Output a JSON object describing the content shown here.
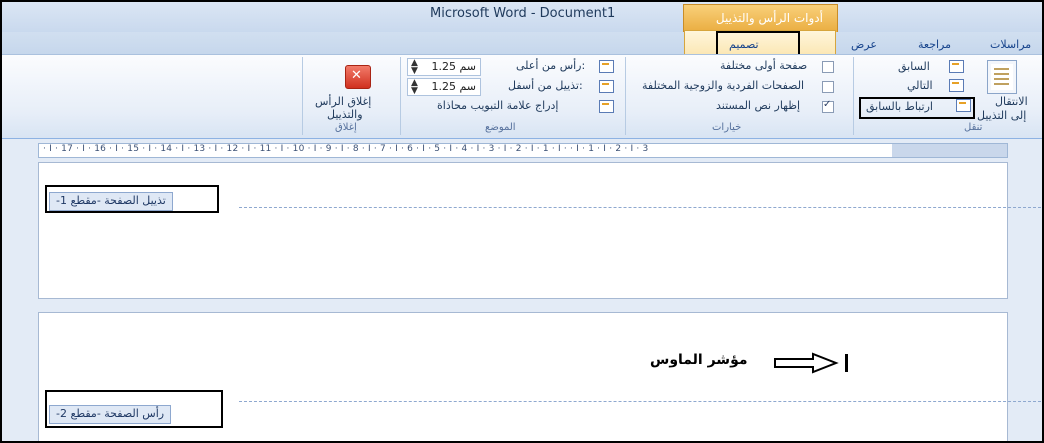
{
  "window": {
    "title": "Microsoft Word - Document1",
    "context_tab_group": "أدوات الرأس والتذييل"
  },
  "tabs": {
    "design": "تصميم",
    "view": "عرض",
    "review": "مراجعة",
    "mailings": "مراسلات"
  },
  "ribbon": {
    "navigation": {
      "group_label": "تنقل",
      "goto_footer_line1": "الانتقال",
      "goto_footer_line2": "إلى التذييل",
      "previous": "السابق",
      "next": "التالي",
      "link_to_previous": "ارتباط بالسابق"
    },
    "options": {
      "group_label": "خيارات",
      "different_first_page": "صفحة أولى مختلفة",
      "different_odd_even": "الصفحات الفردية والزوجية المختلفة",
      "show_document_text": "إظهار نص المستند",
      "different_first_page_checked": false,
      "different_odd_even_checked": false,
      "show_document_text_checked": true
    },
    "position": {
      "group_label": "الموضع",
      "header_from_top_label": "رأس من أعلى:",
      "header_from_top_value": "1.25 سم",
      "footer_from_bottom_label": "تذييل من أسفل:",
      "footer_from_bottom_value": "1.25 سم",
      "insert_alignment_tab": "إدراج علامة التبويب محاذاة"
    },
    "close": {
      "group_label": "إغلاق",
      "close_line1": "إغلاق الرأس",
      "close_line2": "والتذييل"
    }
  },
  "ruler": {
    "text": "· I · 17 · I · 16 · I · 15 · I · 14 · I · 13 · I · 12 · I · 11 · I · 10 · I · 9 · I · 8 · I · 7 · I · 6 · I · 5 · I · 4 · I · 3 · I · 2 · I · 1 · I ·   · I · 1 · I · 2 · I · 3"
  },
  "document": {
    "footer_tag": "-تذييل الصفحة -مقطع 1",
    "header_tag": "-رأس الصفحة -مقطع 2",
    "cursor_label": "مؤشر الماوس",
    "cursor_glyph": "I"
  }
}
